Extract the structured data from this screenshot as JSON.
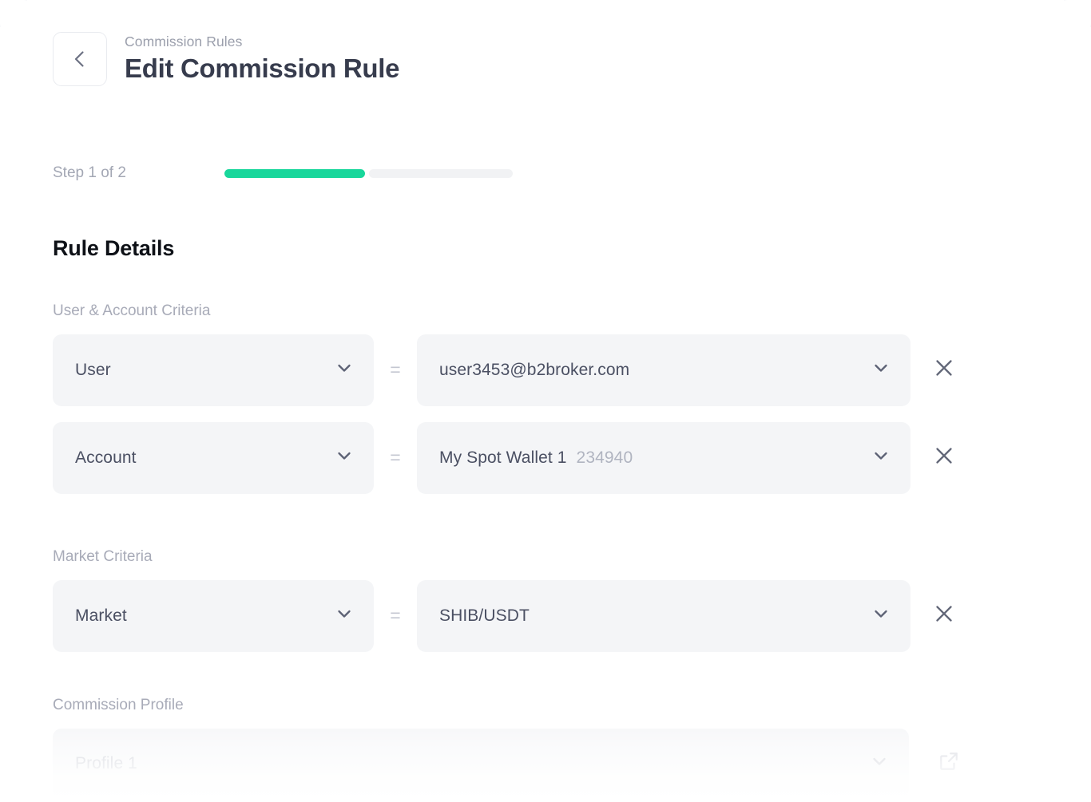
{
  "header": {
    "back_icon": "chevron-left-icon",
    "breadcrumb": "Commission Rules",
    "title": "Edit Commission Rule"
  },
  "stepper": {
    "label": "Step 1 of 2",
    "current_step": 1,
    "total_steps": 2,
    "active_color": "#18d79b",
    "inactive_color": "#f1f2f4"
  },
  "section": {
    "title": "Rule Details"
  },
  "groups": [
    {
      "label": "User & Account Criteria",
      "rows": [
        {
          "key": "User",
          "operator": "=",
          "value": "user3453@b2broker.com",
          "value_muted": "",
          "remove_icon": "close-icon"
        },
        {
          "key": "Account",
          "operator": "=",
          "value": "My Spot Wallet 1",
          "value_muted": "234940",
          "remove_icon": "close-icon"
        }
      ]
    },
    {
      "label": "Market Criteria",
      "rows": [
        {
          "key": "Market",
          "operator": "=",
          "value": "SHIB/USDT",
          "value_muted": "",
          "remove_icon": "close-icon"
        }
      ]
    }
  ],
  "commission_profile": {
    "label": "Commission Profile",
    "value": "Profile 1",
    "external_link_icon": "external-link-icon"
  }
}
